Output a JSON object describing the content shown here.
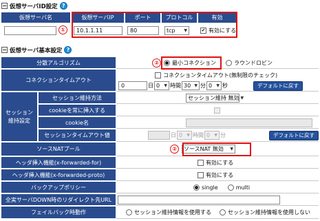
{
  "vip_section": {
    "title": "仮想サーバID設定",
    "col_name": "仮想サーバ名",
    "col_ip": "仮想サーバIP",
    "col_port": "ポート",
    "col_protocol": "プロトコル",
    "col_enabled": "有効",
    "name_value": "",
    "ip_value": "10.1.1.11",
    "port_value": "80",
    "protocol_value": "tcp",
    "enabled_checked": true,
    "enabled_label": "有効にする",
    "marker": "①"
  },
  "basic_section": {
    "title": "仮想サーバ基本設定",
    "dist_algo_label": "分散アルゴリズム",
    "dist_option_1": "最小コネクション",
    "dist_option_2": "ラウンドロビン",
    "dist_selected": "最小コネクション",
    "marker_2": "②",
    "conn_timeout_label": "コネクションタイムアウト",
    "conn_timeout_checkbox": "コネクションタイムアウト(無制限のチェック)",
    "conn_timeout_days": "0",
    "conn_timeout_hours": "0",
    "conn_timeout_minutes": "30",
    "conn_timeout_seconds": "0",
    "unit_day": "日",
    "unit_hour": "時間",
    "unit_minute": "分",
    "unit_second": "秒",
    "default_button": "デフォルトに戻す",
    "session_group_label": "セッション\n維持設定",
    "session_method_label": "セッション維持方法",
    "session_method_value": "セッション維持 無効",
    "cookie_insert_label": "cookieを常に挿入する",
    "cookie_name_label": "cookie名",
    "cookie_name_value": "",
    "session_timeout_label": "セッションタイムアウト値",
    "session_timeout_days": "",
    "session_timeout_hours": "0",
    "session_timeout_minutes": "0",
    "source_nat_label": "ソースNATプール",
    "source_nat_value": "ソースNAT 無効",
    "header_xff_label": "ヘッダ挿入機能(x-forwarded-for)",
    "header_xff_checkbox": "有効にする",
    "header_xfp_label": "ヘッダ挿入機能(x-forwarded-proto)",
    "header_xfp_checkbox": "有効にする",
    "backup_policy_label": "バックアップポリシー",
    "backup_single": "single",
    "backup_multi": "multi",
    "backup_selected": "single",
    "redirect_url_label": "全実サーバDOWN時のリダイレクト先URL",
    "redirect_url_value": "",
    "failback_label": "フェイルバック時動作",
    "failback_option_1": "セッション維持情報を使用する",
    "failback_option_2": "セッション維持情報を使用しない"
  },
  "colors": {
    "header_navy": "#2a4c8e",
    "button_blue": "#24529c",
    "highlight_red": "#e01010",
    "help_blue": "#1e8fd8"
  }
}
